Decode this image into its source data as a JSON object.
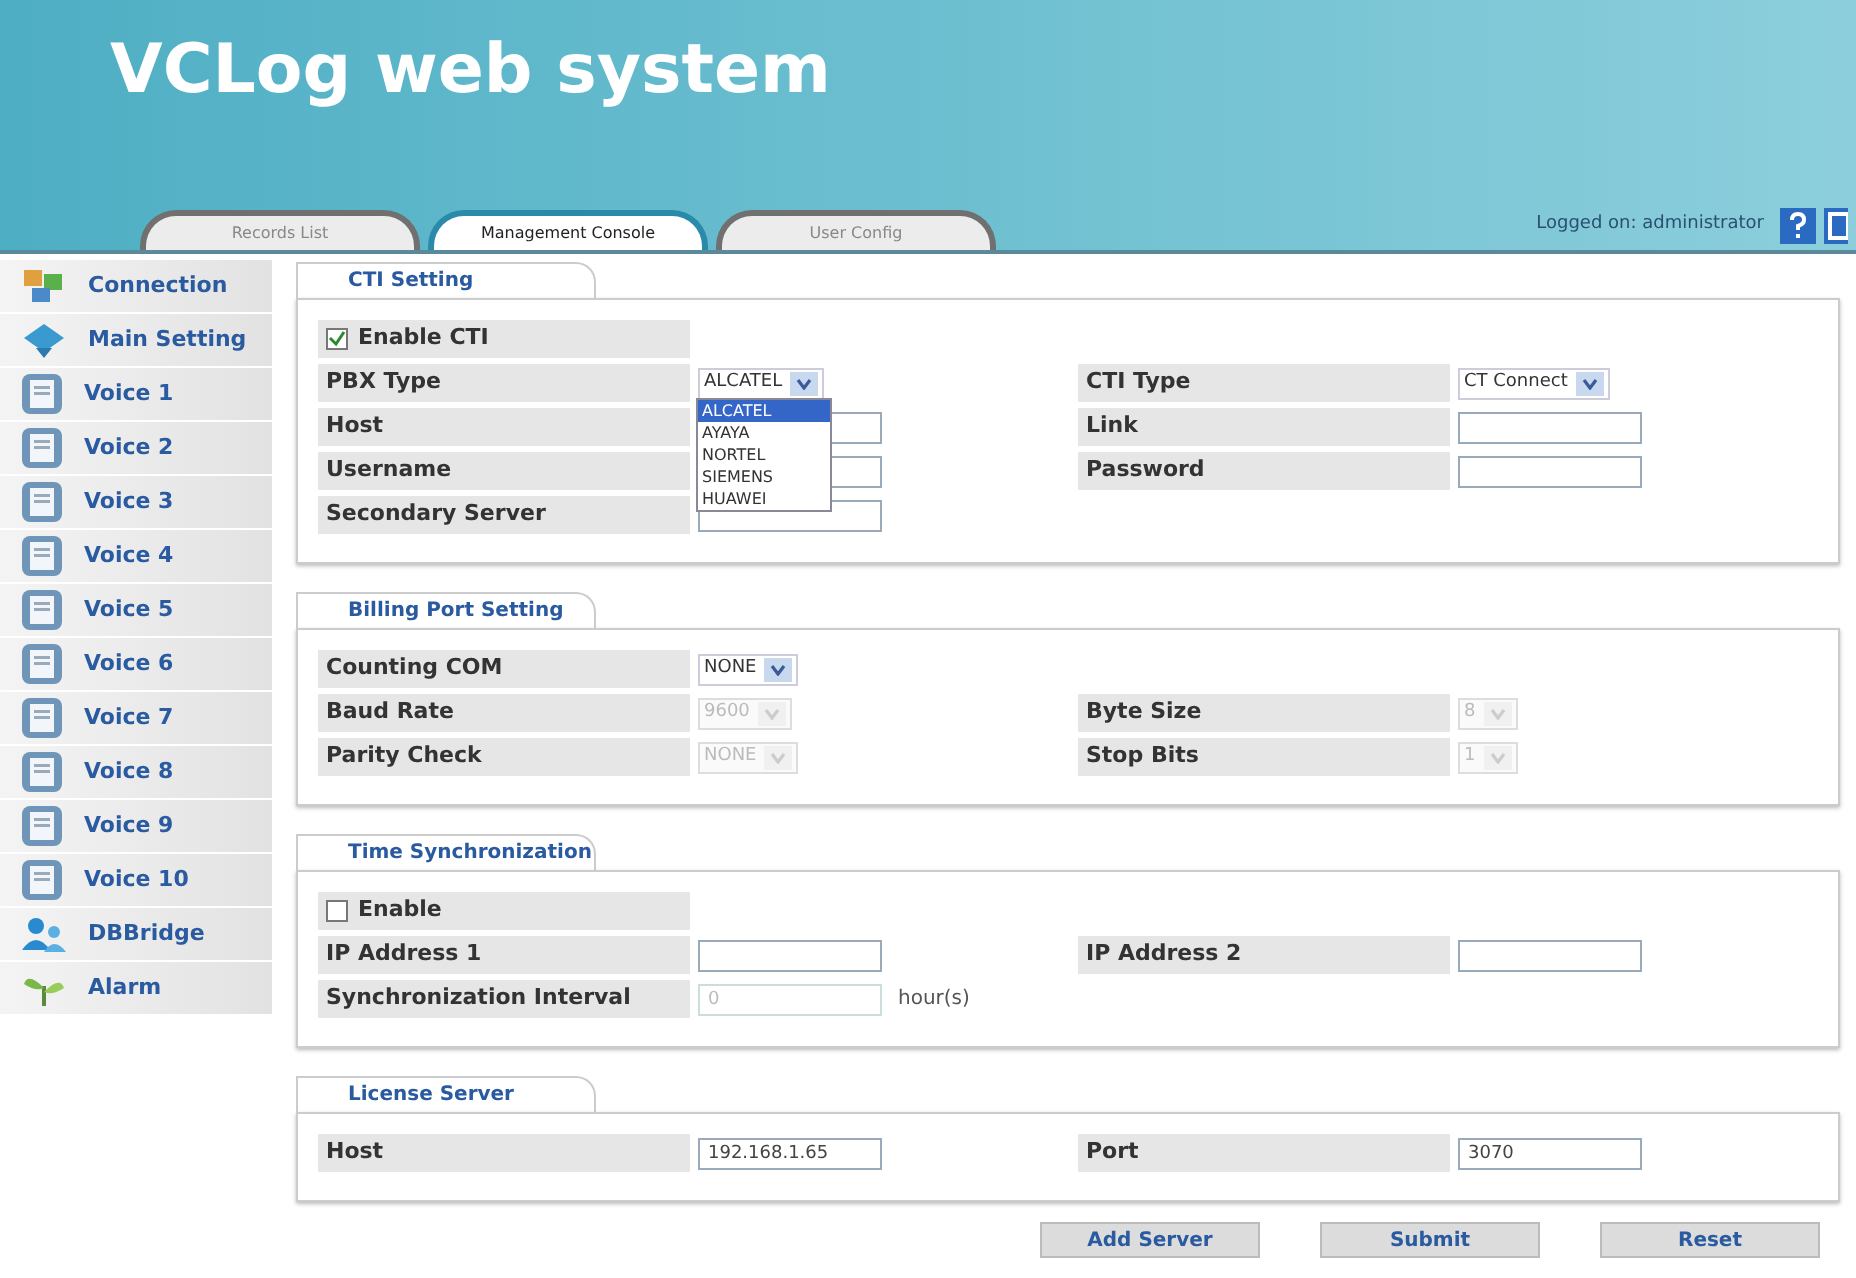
{
  "header": {
    "title": "VCLog web system",
    "logged_on": "Logged on: administrator"
  },
  "tabs": [
    {
      "label": "Records List",
      "selected": false
    },
    {
      "label": "Management Console",
      "selected": true
    },
    {
      "label": "User Config",
      "selected": false
    }
  ],
  "sidebar": {
    "items": [
      {
        "label": "Connection",
        "kind": "connection"
      },
      {
        "label": "Main Setting",
        "kind": "main"
      },
      {
        "label": "Voice 1",
        "kind": "voice"
      },
      {
        "label": "Voice 2",
        "kind": "voice"
      },
      {
        "label": "Voice 3",
        "kind": "voice"
      },
      {
        "label": "Voice 4",
        "kind": "voice"
      },
      {
        "label": "Voice 5",
        "kind": "voice"
      },
      {
        "label": "Voice 6",
        "kind": "voice"
      },
      {
        "label": "Voice 7",
        "kind": "voice"
      },
      {
        "label": "Voice 8",
        "kind": "voice"
      },
      {
        "label": "Voice 9",
        "kind": "voice"
      },
      {
        "label": "Voice 10",
        "kind": "voice"
      },
      {
        "label": "DBBridge",
        "kind": "bridge"
      },
      {
        "label": "Alarm",
        "kind": "alarm"
      }
    ]
  },
  "sections": [
    {
      "title": "CTI Setting",
      "rows": [
        [
          {
            "kind": "checkbox",
            "label": "Enable CTI",
            "checked": true
          }
        ],
        [
          {
            "kind": "select",
            "label": "PBX Type",
            "value": "ALCATEL",
            "disabled": false
          },
          {
            "kind": "select",
            "label": "CTI Type",
            "value": "CT Connect",
            "disabled": false
          }
        ],
        [
          {
            "kind": "text",
            "label": "Host",
            "disabled": false
          },
          {
            "kind": "text",
            "label": "Link",
            "disabled": false
          }
        ],
        [
          {
            "kind": "text",
            "label": "Username",
            "disabled": false
          },
          {
            "kind": "text",
            "label": "Password",
            "disabled": false
          }
        ],
        [
          {
            "kind": "text",
            "label": "Secondary Server",
            "disabled": false
          }
        ]
      ],
      "dropdown_list": [
        {
          "label": "ALCATEL",
          "selected": true
        },
        {
          "label": "AYAYA",
          "selected": false
        },
        {
          "label": "NORTEL",
          "selected": false
        },
        {
          "label": "SIEMENS",
          "selected": false
        },
        {
          "label": "HUAWEI",
          "selected": false
        }
      ]
    },
    {
      "title": "Billing Port Setting",
      "rows": [
        [
          {
            "kind": "select",
            "label": "Counting COM",
            "value": "NONE",
            "disabled": false
          }
        ],
        [
          {
            "kind": "select",
            "label": "Baud Rate",
            "value": "9600",
            "disabled": true
          },
          {
            "kind": "select",
            "label": "Byte Size",
            "value": "8",
            "disabled": true
          }
        ],
        [
          {
            "kind": "select",
            "label": "Parity Check",
            "value": "NONE",
            "disabled": true
          },
          {
            "kind": "select",
            "label": "Stop Bits",
            "value": "1",
            "disabled": true
          }
        ]
      ]
    },
    {
      "title": "Time Synchronization",
      "rows": [
        [
          {
            "kind": "checkbox",
            "label": "Enable",
            "checked": false
          }
        ],
        [
          {
            "kind": "text",
            "label": "IP Address 1",
            "disabled": false
          },
          {
            "kind": "text",
            "label": "IP Address 2",
            "disabled": false
          }
        ],
        [
          {
            "kind": "text",
            "label": "Synchronization Interval",
            "value": "0",
            "disabled": true,
            "suffix": "hour(s)"
          }
        ]
      ]
    },
    {
      "title": "License Server",
      "rows": [
        [
          {
            "kind": "text",
            "label": "Host",
            "value": "192.168.1.65",
            "disabled": false
          },
          {
            "kind": "text",
            "label": "Port",
            "value": "3070",
            "disabled": false
          }
        ]
      ]
    }
  ],
  "buttons": [
    "Add Server",
    "Submit",
    "Reset"
  ]
}
